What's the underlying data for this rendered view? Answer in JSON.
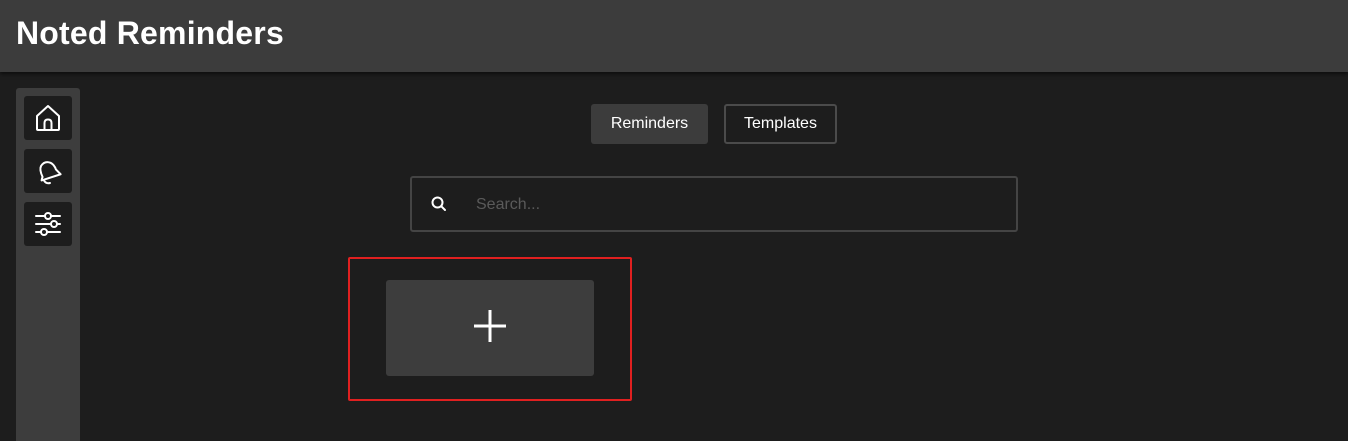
{
  "app": {
    "title": "Noted Reminders"
  },
  "sidebar": {
    "items": [
      {
        "name": "home",
        "icon": "home-icon"
      },
      {
        "name": "notifications",
        "icon": "bell-icon"
      },
      {
        "name": "settings",
        "icon": "sliders-icon"
      }
    ]
  },
  "tabs": [
    {
      "label": "Reminders",
      "active": true
    },
    {
      "label": "Templates",
      "active": false
    }
  ],
  "search": {
    "placeholder": "Search...",
    "value": "",
    "icon": "search-icon"
  },
  "add_card": {
    "icon": "plus-icon"
  },
  "colors": {
    "background": "#1d1d1d",
    "titlebar": "#3c3c3c",
    "sidebar": "#3d3d3d",
    "highlight": "#e02020"
  }
}
